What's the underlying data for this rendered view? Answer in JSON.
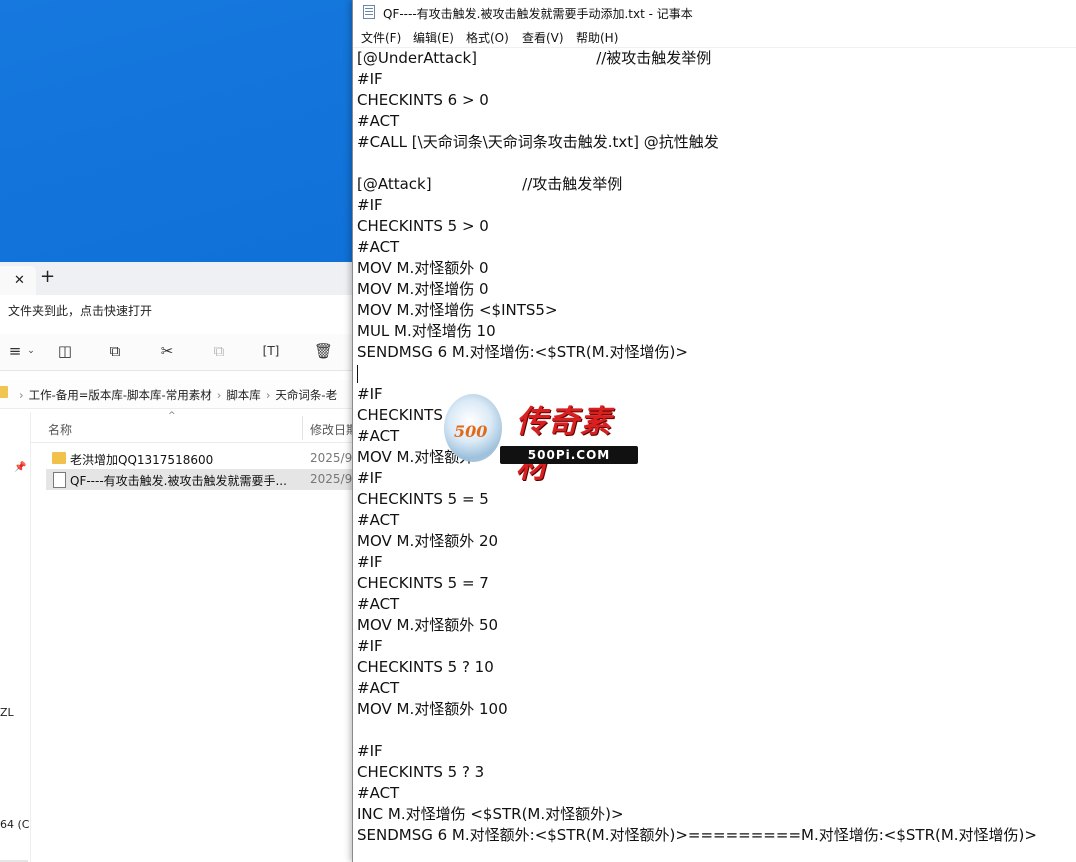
{
  "explorer": {
    "hint": "文件夹到此，点击快速打开",
    "address": [
      "工作-备用=版本库-脚本库-常用素材",
      "脚本库",
      "天命词条-老"
    ],
    "column_name": "名称",
    "column_date": "修改日期",
    "nav_zl": "ZL",
    "nav_64": "64 (C",
    "files": [
      {
        "name": "老洪增加QQ1317518600",
        "date": "2025/9",
        "type": "folder",
        "selected": false
      },
      {
        "name": "QF----有攻击触发.被攻击触发就需要手...",
        "date": "2025/9",
        "type": "doc",
        "selected": true
      }
    ]
  },
  "notepad": {
    "title": "QF----有攻击触发.被攻击触发就需要手动添加.txt - 记事本",
    "menu": [
      "文件(F)",
      "编辑(E)",
      "格式(O)",
      "查看(V)",
      "帮助(H)"
    ],
    "lines": [
      "[@UnderAttack]                         //被攻击触发举例",
      "#IF",
      "CHECKINTS 6 > 0",
      "#ACT",
      "#CALL [\\天命词条\\天命词条攻击触发.txt] @抗性触发",
      "",
      "[@Attack]                   //攻击触发举例",
      "#IF",
      "CHECKINTS 5 > 0",
      "#ACT",
      "MOV M.对怪额外 0",
      "MOV M.对怪增伤 0",
      "MOV M.对怪增伤 <$INTS5>",
      "MUL M.对怪增伤 10",
      "SENDMSG 6 M.对怪增伤:<$STR(M.对怪增伤)>",
      "",
      "#IF",
      "CHECKINTS",
      "#ACT",
      "MOV M.对怪额外",
      "#IF",
      "CHECKINTS 5 = 5",
      "#ACT",
      "MOV M.对怪额外 20",
      "#IF",
      "CHECKINTS 5 = 7",
      "#ACT",
      "MOV M.对怪额外 50",
      "#IF",
      "CHECKINTS 5 ? 10",
      "#ACT",
      "MOV M.对怪额外 100",
      "",
      "#IF",
      "CHECKINTS 5 ? 3",
      "#ACT",
      "INC M.对怪增伤 <$STR(M.对怪额外)>",
      "SENDMSG 6 M.对怪额外:<$STR(M.对怪额外)>=========M.对怪增伤:<$STR(M.对怪增伤)>"
    ],
    "caret_line": 15
  },
  "watermark": {
    "text_cn": "传奇素材",
    "number": "500",
    "url": "500Pi.COM"
  }
}
